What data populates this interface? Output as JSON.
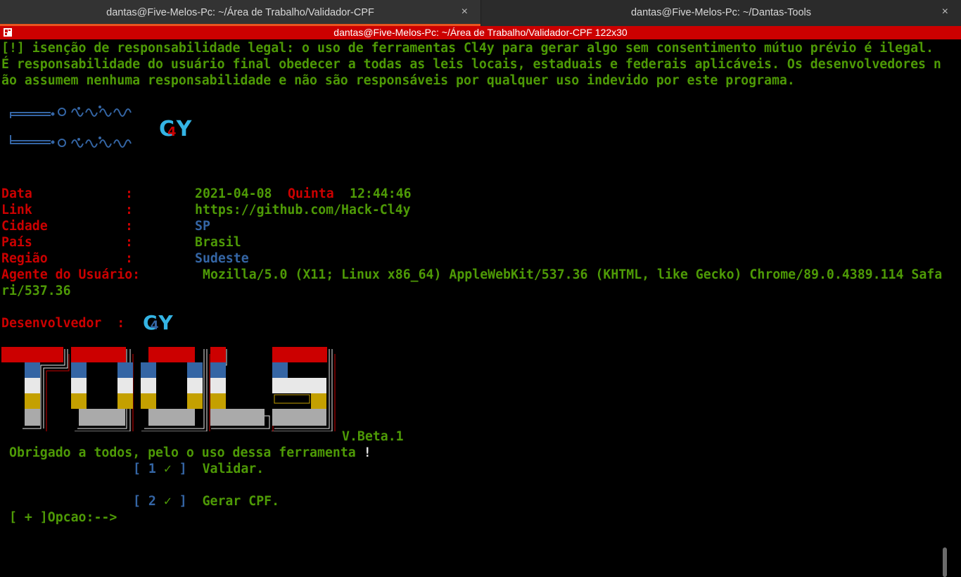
{
  "tabs": [
    {
      "title": "dantas@Five-Melos-Pc: ~/Área de Trabalho/Validador-CPF",
      "close": "×"
    },
    {
      "title": "dantas@Five-Melos-Pc: ~/Dantas-Tools",
      "close": "×"
    }
  ],
  "window_title": "dantas@Five-Melos-Pc: ~/Área de Trabalho/Validador-CPF 122x30",
  "disclaimer": [
    "[!] isenção de responsabilidade legal: o uso de ferramentas Cl4y para gerar algo sem consentimento mútuo prévio é ilegal.",
    "É responsabilidade do usuário final obedecer a todas as leis locais, estaduais e federais aplicáveis. Os desenvolvedores n",
    "ão assumem nenhuma responsabilidade e não são responsáveis por qualquer uso indevido por este programa."
  ],
  "banner_logo": {
    "c": "C",
    "four": "4",
    "y": "Y"
  },
  "info": {
    "data_label": "Data",
    "sep": ":",
    "date": "2021-04-08",
    "weekday": "Quinta",
    "time": "12:44:46",
    "link_label": "Link",
    "link": "https://github.com/Hack-Cl4y",
    "cidade_label": "Cidade",
    "cidade": "SP",
    "pais_label": "País",
    "pais": "Brasil",
    "regiao_label": "Região",
    "regiao": "Sudeste",
    "agent_label": "Agente do Usuário:",
    "agent_1": "Mozilla/5.0 (X11; Linux x86_64) AppleWebKit/537.36 (KHTML, like Gecko) Chrome/89.0.4389.114 Safa",
    "agent_2": "ri/537.36",
    "dev_label": "Desenvolvedor  :"
  },
  "dev_logo": {
    "c": "C",
    "four": "4",
    "y": "Y"
  },
  "tools_version": "V.Beta.1",
  "thanks": {
    "text": "Obrigado a todos, pelo o uso dessa ferramenta ",
    "bang": "!"
  },
  "menu": [
    {
      "open": "[",
      "num": "1",
      "check": "✓",
      "close": "]",
      "label": "Validar."
    },
    {
      "open": "[",
      "num": "2",
      "check": "✓",
      "close": "]",
      "label": "Gerar CPF."
    }
  ],
  "prompt": {
    "bracket": "[ + ]",
    "text": "Opcao:-->"
  },
  "colors": {
    "green": "#4e9a06",
    "red": "#cc0000",
    "blue": "#3465a4",
    "white": "#e8e8e8",
    "yellow": "#c4a000",
    "grey": "#aaaaaa",
    "cyan": "#34b4e4"
  }
}
